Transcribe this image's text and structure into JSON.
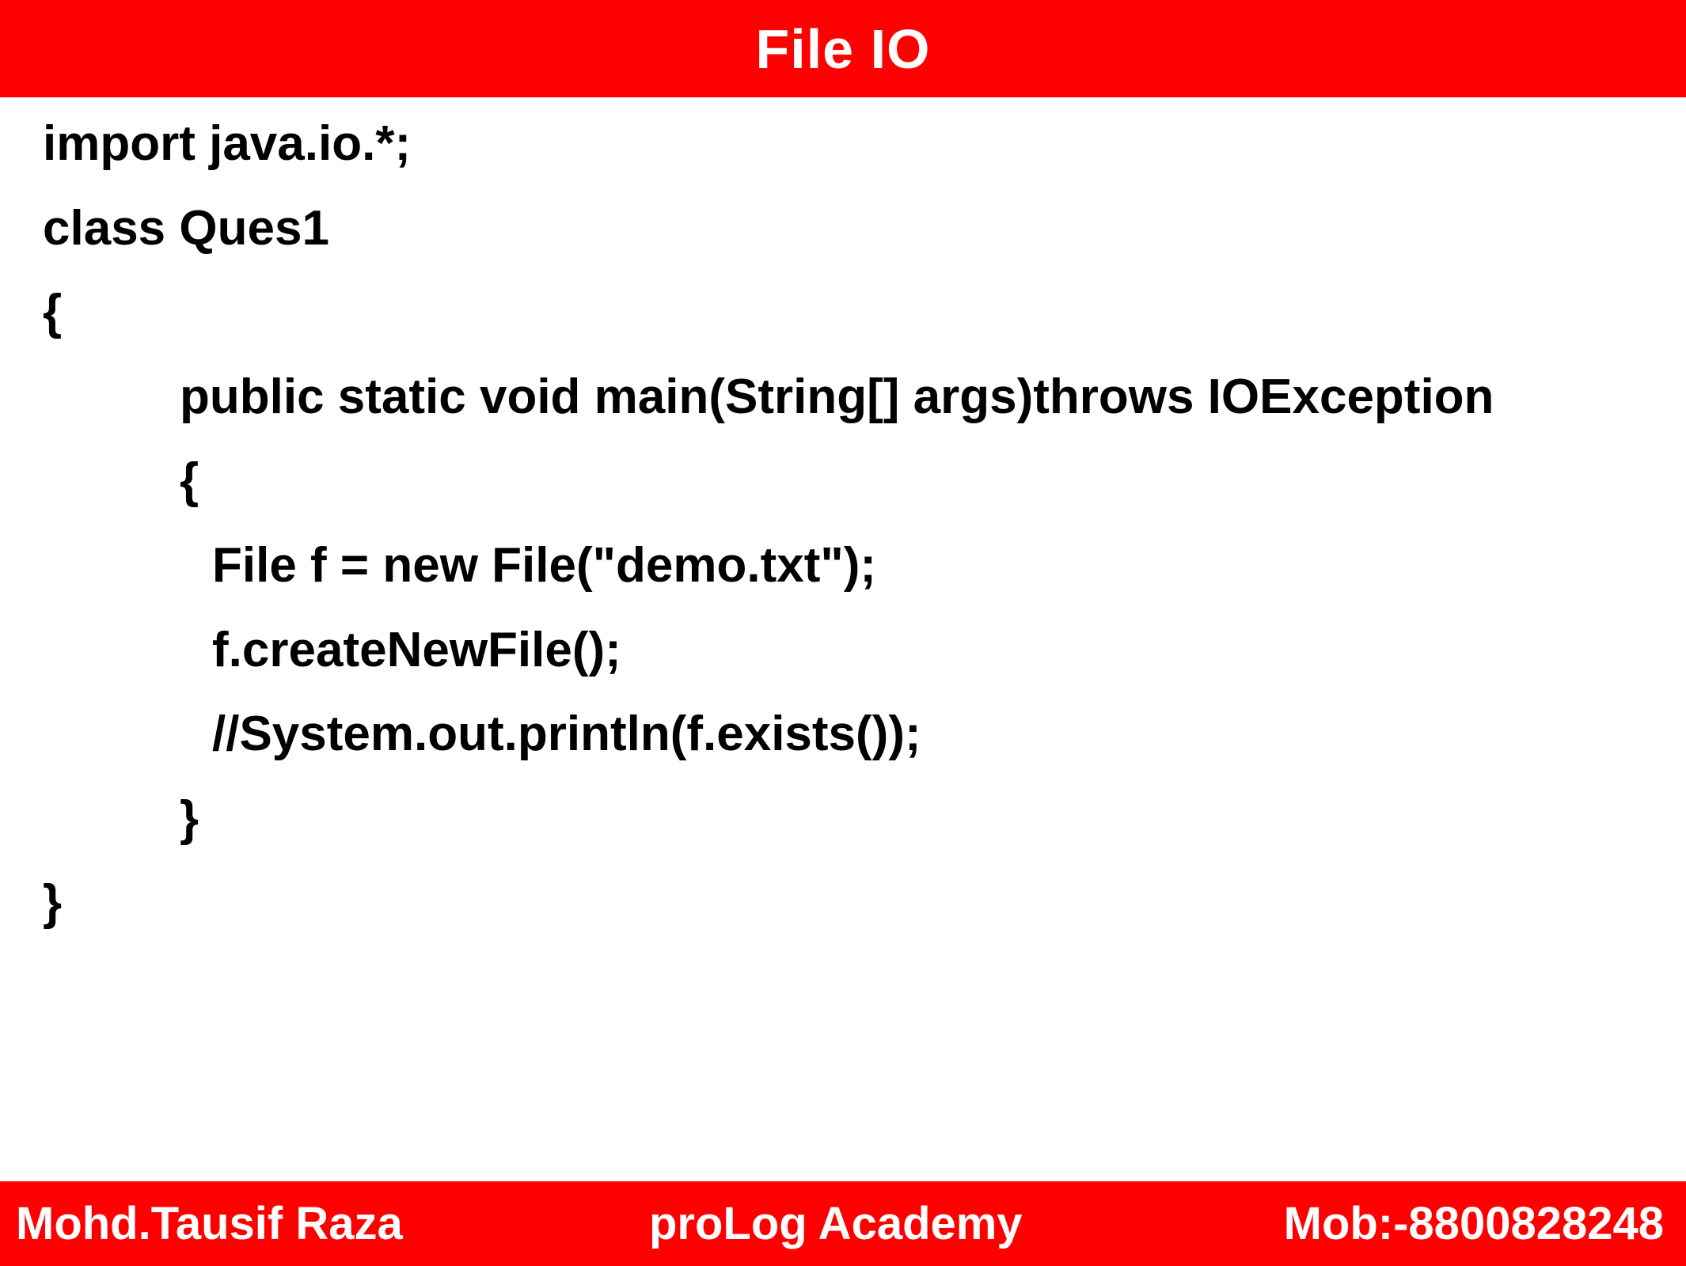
{
  "header": {
    "title": "File IO"
  },
  "code": {
    "lines": [
      "import java.io.*;",
      "class Ques1",
      "{",
      "public static void main(String[] args)throws IOException",
      "{",
      "File f = new File(\"demo.txt\");",
      "f.createNewFile();",
      "//System.out.println(f.exists());",
      "}",
      "}"
    ]
  },
  "footer": {
    "author": "Mohd.Tausif Raza",
    "academy": "proLog Academy",
    "mobile": "Mob:-8800828248"
  },
  "colors": {
    "bar": "#ff0000",
    "bar_text": "#ffffff",
    "code_text": "#000000",
    "background": "#ffffff"
  }
}
